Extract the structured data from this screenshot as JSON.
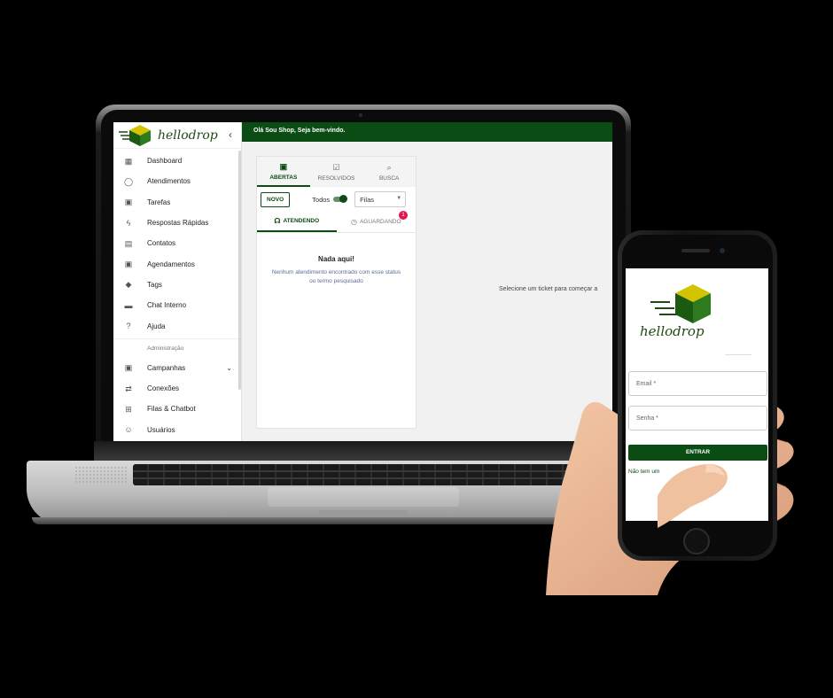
{
  "app": {
    "brand_name": "hellodrop",
    "colors": {
      "primary": "#0b4b14",
      "badge": "#e0174e",
      "background": "#000000"
    }
  },
  "sidebar": {
    "items": [
      {
        "label": "Dashboard",
        "icon": "dashboard-icon"
      },
      {
        "label": "Atendimentos",
        "icon": "whatsapp-icon"
      },
      {
        "label": "Tarefas",
        "icon": "task-icon"
      },
      {
        "label": "Respostas Rápidas",
        "icon": "bolt-icon"
      },
      {
        "label": "Contatos",
        "icon": "contacts-icon"
      },
      {
        "label": "Agendamentos",
        "icon": "calendar-icon"
      },
      {
        "label": "Tags",
        "icon": "tag-icon"
      },
      {
        "label": "Chat Interno",
        "icon": "chat-icon"
      },
      {
        "label": "Ajuda",
        "icon": "help-icon"
      }
    ],
    "section_label": "Administração",
    "admin_items": [
      {
        "label": "Campanhas",
        "icon": "campaign-icon"
      },
      {
        "label": "Conexões",
        "icon": "connections-icon"
      },
      {
        "label": "Filas & Chatbot",
        "icon": "queue-icon"
      },
      {
        "label": "Usuários",
        "icon": "users-icon"
      }
    ]
  },
  "topbar": {
    "greeting": "Olá Sou Shop, Seja bem-vindo."
  },
  "tickets": {
    "tabs": [
      {
        "label": "ABERTAS",
        "icon": "inbox-icon"
      },
      {
        "label": "RESOLVIDOS",
        "icon": "check-box-icon"
      },
      {
        "label": "BUSCA",
        "icon": "search-icon"
      }
    ],
    "new_button": "NOVO",
    "toggle_label": "Todos",
    "queue_select": "Filas",
    "subtabs": [
      {
        "label": "ATENDENDO",
        "icon": "headset-icon"
      },
      {
        "label": "AGUARDANDO",
        "icon": "clock-icon",
        "badge": "1"
      }
    ],
    "empty_title": "Nada aqui!",
    "empty_text": "Nenhum atendimento encontrado com esse status ou termo pesquisado",
    "detail_placeholder": "Selecione um ticket para começar a"
  },
  "phone": {
    "brand_name": "hellodrop",
    "email_placeholder": "Email *",
    "password_placeholder": "Senha *",
    "submit_label": "ENTRAR",
    "signup_link": "Não tem um"
  }
}
